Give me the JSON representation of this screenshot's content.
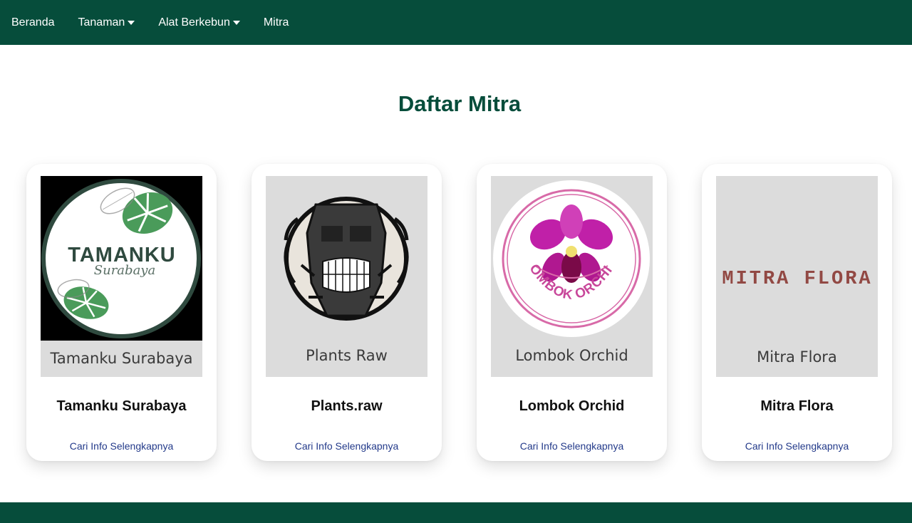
{
  "nav": {
    "items": [
      {
        "label": "Beranda",
        "dropdown": false
      },
      {
        "label": "Tanaman",
        "dropdown": true
      },
      {
        "label": "Alat Berkebun",
        "dropdown": true
      },
      {
        "label": "Mitra",
        "dropdown": false
      }
    ],
    "background": "#064d3b"
  },
  "page": {
    "title": "Daftar Mitra",
    "title_color": "#064d3b"
  },
  "partners": [
    {
      "name": "Tamanku Surabaya",
      "image_caption": "Tamanku Surabaya",
      "logo_text": "TAMANKU",
      "logo_subtext": "Surabaya",
      "link": "Cari Info Selengkapnya"
    },
    {
      "name": "Plants.raw",
      "image_caption": "Plants Raw",
      "link": "Cari Info Selengkapnya"
    },
    {
      "name": "Lombok Orchid",
      "image_caption": "Lombok Orchid",
      "logo_text": "LOMBOK ORCHID",
      "link": "Cari Info Selengkapnya"
    },
    {
      "name": "Mitra Flora",
      "image_caption": "Mitra Flora",
      "logo_text": "MITRA FLORA",
      "link": "Cari Info Selengkapnya"
    }
  ]
}
